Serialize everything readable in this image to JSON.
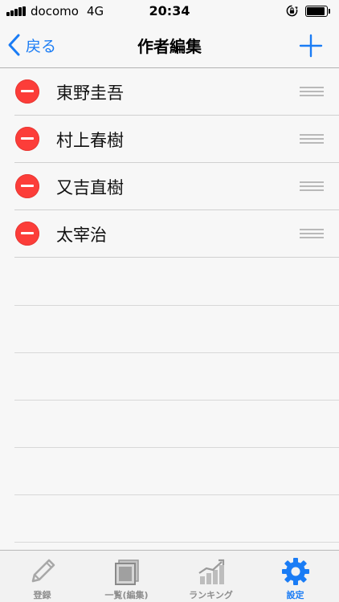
{
  "status_bar": {
    "carrier": "docomo",
    "network": "4G",
    "time": "20:34"
  },
  "nav": {
    "back_label": "戻る",
    "title": "作者編集",
    "add_icon": "plus-icon"
  },
  "authors": [
    {
      "name": "東野圭吾"
    },
    {
      "name": "村上春樹"
    },
    {
      "name": "又吉直樹"
    },
    {
      "name": "太宰治"
    }
  ],
  "tabs": [
    {
      "label": "登録",
      "icon": "pencil-icon",
      "active": false
    },
    {
      "label": "一覧(編集)",
      "icon": "list-icon",
      "active": false
    },
    {
      "label": "ランキング",
      "icon": "chart-icon",
      "active": false
    },
    {
      "label": "設定",
      "icon": "gear-icon",
      "active": true
    }
  ],
  "colors": {
    "accent": "#1a7cf5",
    "delete": "#fc3d39",
    "inactive_tab": "#8e8e8e"
  }
}
